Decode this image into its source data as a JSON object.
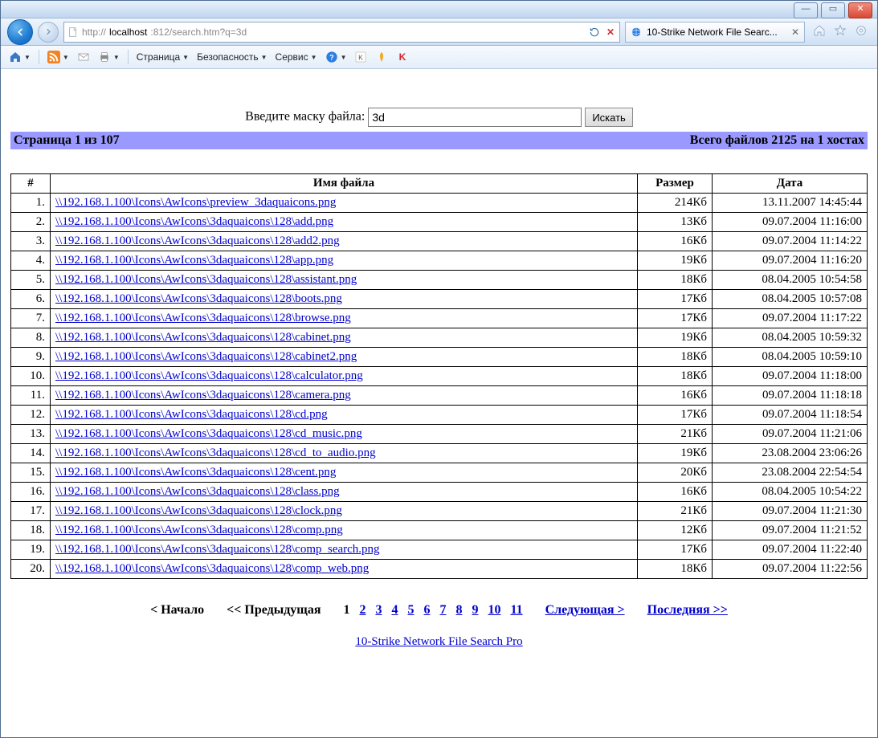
{
  "window": {
    "url_prefix": "http://",
    "url_host": "localhost",
    "url_rest": ":812/search.htm?q=3d",
    "tab_title": "10-Strike Network File Searc..."
  },
  "toolbar": {
    "page": "Страница",
    "security": "Безопасность",
    "service": "Сервис"
  },
  "search": {
    "label": "Введите маску файла:",
    "value": "3d",
    "button": "Искать"
  },
  "status": {
    "page": "Страница 1 из 107",
    "total": "Всего файлов 2125 на 1 хостах"
  },
  "columns": {
    "num": "#",
    "name": "Имя файла",
    "size": "Размер",
    "date": "Дата"
  },
  "rows": [
    {
      "n": "1.",
      "name": "\\\\192.168.1.100\\Icons\\AwIcons\\preview_3daquaicons.png",
      "size": "214Кб",
      "date": "13.11.2007 14:45:44"
    },
    {
      "n": "2.",
      "name": "\\\\192.168.1.100\\Icons\\AwIcons\\3daquaicons\\128\\add.png",
      "size": "13Кб",
      "date": "09.07.2004 11:16:00"
    },
    {
      "n": "3.",
      "name": "\\\\192.168.1.100\\Icons\\AwIcons\\3daquaicons\\128\\add2.png",
      "size": "16Кб",
      "date": "09.07.2004 11:14:22"
    },
    {
      "n": "4.",
      "name": "\\\\192.168.1.100\\Icons\\AwIcons\\3daquaicons\\128\\app.png",
      "size": "19Кб",
      "date": "09.07.2004 11:16:20"
    },
    {
      "n": "5.",
      "name": "\\\\192.168.1.100\\Icons\\AwIcons\\3daquaicons\\128\\assistant.png",
      "size": "18Кб",
      "date": "08.04.2005 10:54:58"
    },
    {
      "n": "6.",
      "name": "\\\\192.168.1.100\\Icons\\AwIcons\\3daquaicons\\128\\boots.png",
      "size": "17Кб",
      "date": "08.04.2005 10:57:08"
    },
    {
      "n": "7.",
      "name": "\\\\192.168.1.100\\Icons\\AwIcons\\3daquaicons\\128\\browse.png",
      "size": "17Кб",
      "date": "09.07.2004 11:17:22"
    },
    {
      "n": "8.",
      "name": "\\\\192.168.1.100\\Icons\\AwIcons\\3daquaicons\\128\\cabinet.png",
      "size": "19Кб",
      "date": "08.04.2005 10:59:32"
    },
    {
      "n": "9.",
      "name": "\\\\192.168.1.100\\Icons\\AwIcons\\3daquaicons\\128\\cabinet2.png",
      "size": "18Кб",
      "date": "08.04.2005 10:59:10"
    },
    {
      "n": "10.",
      "name": "\\\\192.168.1.100\\Icons\\AwIcons\\3daquaicons\\128\\calculator.png",
      "size": "18Кб",
      "date": "09.07.2004 11:18:00"
    },
    {
      "n": "11.",
      "name": "\\\\192.168.1.100\\Icons\\AwIcons\\3daquaicons\\128\\camera.png",
      "size": "16Кб",
      "date": "09.07.2004 11:18:18"
    },
    {
      "n": "12.",
      "name": "\\\\192.168.1.100\\Icons\\AwIcons\\3daquaicons\\128\\cd.png",
      "size": "17Кб",
      "date": "09.07.2004 11:18:54"
    },
    {
      "n": "13.",
      "name": "\\\\192.168.1.100\\Icons\\AwIcons\\3daquaicons\\128\\cd_music.png",
      "size": "21Кб",
      "date": "09.07.2004 11:21:06"
    },
    {
      "n": "14.",
      "name": "\\\\192.168.1.100\\Icons\\AwIcons\\3daquaicons\\128\\cd_to_audio.png",
      "size": "19Кб",
      "date": "23.08.2004 23:06:26"
    },
    {
      "n": "15.",
      "name": "\\\\192.168.1.100\\Icons\\AwIcons\\3daquaicons\\128\\cent.png",
      "size": "20Кб",
      "date": "23.08.2004 22:54:54"
    },
    {
      "n": "16.",
      "name": "\\\\192.168.1.100\\Icons\\AwIcons\\3daquaicons\\128\\class.png",
      "size": "16Кб",
      "date": "08.04.2005 10:54:22"
    },
    {
      "n": "17.",
      "name": "\\\\192.168.1.100\\Icons\\AwIcons\\3daquaicons\\128\\clock.png",
      "size": "21Кб",
      "date": "09.07.2004 11:21:30"
    },
    {
      "n": "18.",
      "name": "\\\\192.168.1.100\\Icons\\AwIcons\\3daquaicons\\128\\comp.png",
      "size": "12Кб",
      "date": "09.07.2004 11:21:52"
    },
    {
      "n": "19.",
      "name": "\\\\192.168.1.100\\Icons\\AwIcons\\3daquaicons\\128\\comp_search.png",
      "size": "17Кб",
      "date": "09.07.2004 11:22:40"
    },
    {
      "n": "20.",
      "name": "\\\\192.168.1.100\\Icons\\AwIcons\\3daquaicons\\128\\comp_web.png",
      "size": "18Кб",
      "date": "09.07.2004 11:22:56"
    }
  ],
  "pager": {
    "first": "< Начало",
    "prev": "<< Предыдущая",
    "pages": [
      "1",
      "2",
      "3",
      "4",
      "5",
      "6",
      "7",
      "8",
      "9",
      "10",
      "11"
    ],
    "current": "1",
    "next": "Следующая >",
    "last": "Последняя >>"
  },
  "footer": {
    "link": "10-Strike Network File Search Pro"
  }
}
